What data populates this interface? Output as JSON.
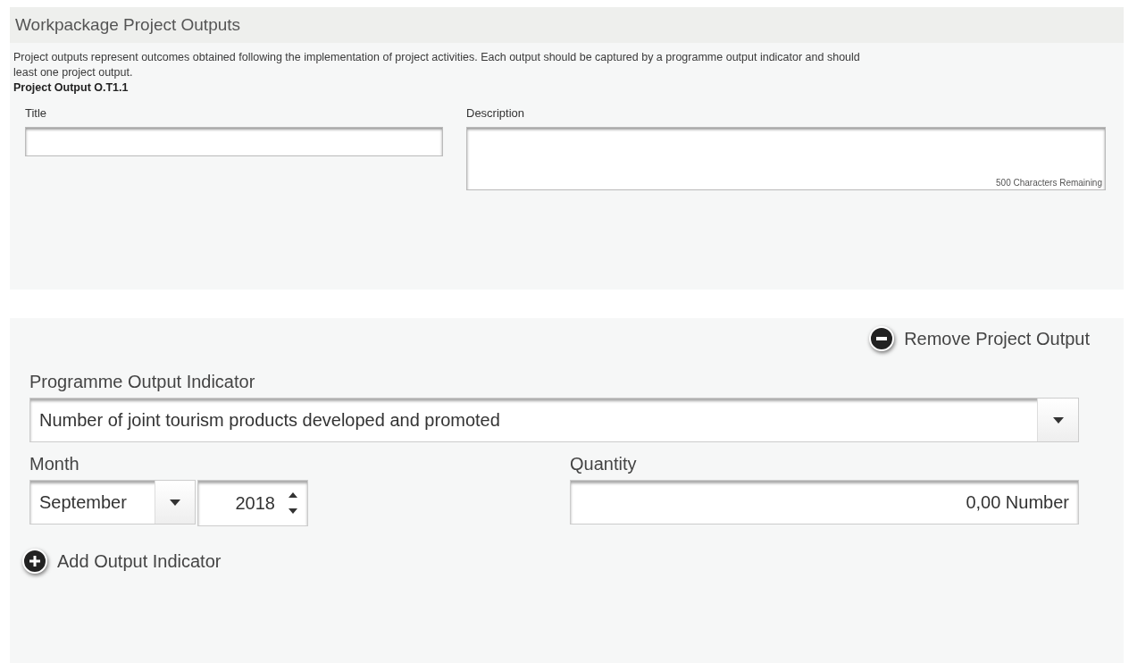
{
  "section_title": "Workpackage Project Outputs",
  "intro_lines": [
    "Project outputs represent outcomes obtained following the implementation of project activities. Each output should be captured by a programme output indicator and should",
    "least one project output."
  ],
  "output_heading": "Project Output O.T1.1",
  "title_field": {
    "label": "Title"
  },
  "description_field": {
    "label": "Description",
    "counter": "500 Characters Remaining"
  },
  "remove_button": "Remove Project Output",
  "indicator": {
    "label": "Programme Output Indicator",
    "value": "Number of joint tourism products developed and promoted"
  },
  "month": {
    "label": "Month",
    "month": "September",
    "year": "2018"
  },
  "quantity": {
    "label": "Quantity",
    "value": "0,00 Number"
  },
  "add_button": "Add Output Indicator"
}
